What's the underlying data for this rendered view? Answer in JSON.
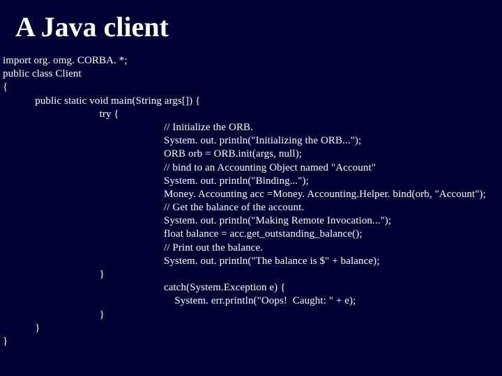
{
  "title": "A Java client",
  "code": {
    "l01": "import org. omg. CORBA. *;",
    "l02": "public class Client",
    "l03": "{",
    "l04": "            public static void main(String args[]) {",
    "l05": "                                    try {",
    "l06": "                                                            // Initialize the ORB.",
    "l07": "                                                            System. out. println(\"Initializing the ORB...\");",
    "l08": "                                                            ORB orb = ORB.init(args, null);",
    "l09": "                                                            // bind to an Accounting Object named \"Account\"",
    "l10": "                                                            System. out. println(\"Binding...\");",
    "l11": "                                                            Money. Accounting acc =Money. Accounting.Helper. bind(orb, \"Account\");",
    "l12": "                                                            // Get the balance of the account.",
    "l13": "                                                            System. out. println(\"Making Remote Invocation...\");",
    "l14": "                                                            float balance = acc.get_outstanding_balance();",
    "l15": "                                                            // Print out the balance.",
    "l16": "                                                            System. out. println(\"The balance is $\" + balance);",
    "l17": "                                    }",
    "l18": "                                                            catch(System.Exception e) {",
    "l19": "                                                                System. err.println(\"Oops!  Caught: \" + e);",
    "l20": "                                    }",
    "l21": "            }",
    "l22": "}"
  }
}
